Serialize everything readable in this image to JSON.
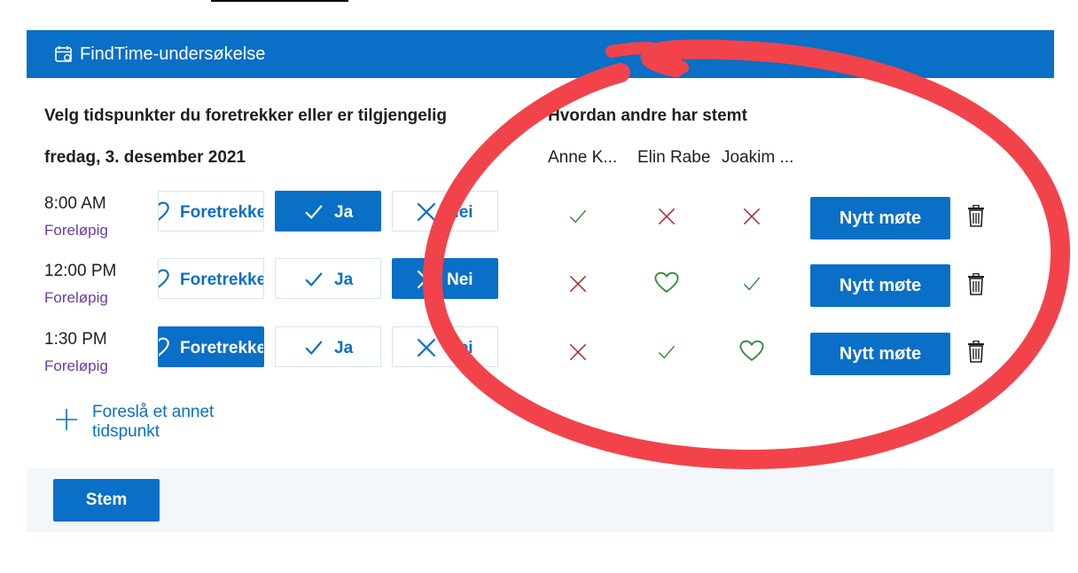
{
  "header": {
    "title": "FindTime-undersøkelse",
    "icon": "calendar-icon"
  },
  "left": {
    "heading": "Velg tidspunkter du foretrekker eller er tilgjengelig",
    "date": "fredag, 3. desember 2021",
    "slots": [
      {
        "time": "8:00 AM",
        "status": "Foreløpig",
        "prefer_label": "Foretrekker",
        "yes_label": "Ja",
        "no_label": "Nei",
        "selected": "yes"
      },
      {
        "time": "12:00 PM",
        "status": "Foreløpig",
        "prefer_label": "Foretrekker",
        "yes_label": "Ja",
        "no_label": "Nei",
        "selected": "no"
      },
      {
        "time": "1:30 PM",
        "status": "Foreløpig",
        "prefer_label": "Foretrekker",
        "yes_label": "Ja",
        "no_label": "Nei",
        "selected": "prefer"
      }
    ],
    "suggest_label": "Foreslå et annet tidspunkt"
  },
  "right": {
    "heading": "Hvordan andre har stemt",
    "voters": [
      "Anne K...",
      "Elin Rabe",
      "Joakim ..."
    ],
    "votes": [
      [
        "yes",
        "no",
        "no"
      ],
      [
        "no",
        "prefer",
        "yes"
      ],
      [
        "no",
        "yes",
        "prefer"
      ]
    ],
    "new_meeting_label": "Nytt møte"
  },
  "footer": {
    "vote_label": "Stem"
  },
  "colors": {
    "accent": "#0a6fc6",
    "yes": "#2e8b3a",
    "no": "#a4262c",
    "status": "#6b3aa5",
    "annotation": "#f2434b"
  }
}
